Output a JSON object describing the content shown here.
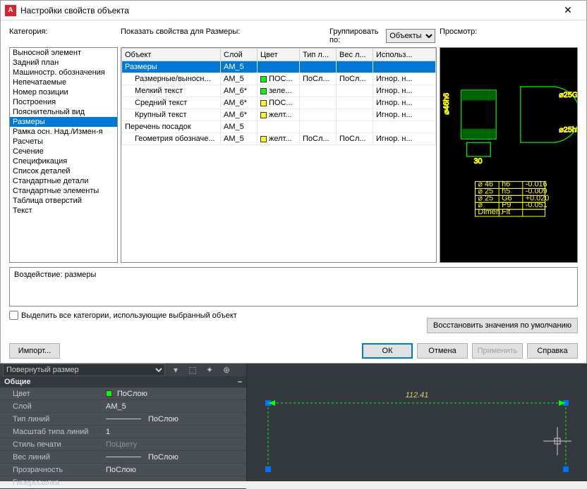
{
  "title": "Настройки свойств объекта",
  "labels": {
    "category": "Категория:",
    "show_props": "Показать свойства для Размеры:",
    "group_by": "Группировать по:",
    "group_value": "Объекты",
    "preview": "Просмотр:",
    "effect": "Воздействие: размеры",
    "select_all": "Выделить все категории, использующие выбранный объект",
    "restore": "Восстановить значения по умолчанию",
    "import": "Импорт...",
    "ok": "ОК",
    "cancel": "Отмена",
    "apply": "Применить",
    "help": "Справка"
  },
  "categories": [
    "Выносной элемент",
    "Задний план",
    "Машиностр. обозначения",
    "Непечатаемые",
    "Номер позиции",
    "Построения",
    "Пояснительный вид",
    "Размеры",
    "Рамка осн. Над./Измен-я",
    "Расчеты",
    "Сечение",
    "Спецификация",
    "Список деталей",
    "Стандартные детали",
    "Стандартные элементы",
    "Таблица отверстий",
    "Текст"
  ],
  "selected_category_index": 7,
  "columns": [
    "Объект",
    "Слой",
    "Цвет",
    "Тип л...",
    "Вес л...",
    "Использ..."
  ],
  "rows": [
    {
      "indent": 0,
      "object": "Размеры",
      "layer": "AM_5",
      "color": "",
      "color_hex": "",
      "linetype": "",
      "lineweight": "",
      "use": "",
      "selected": true
    },
    {
      "indent": 1,
      "object": "Размерные/выносн...",
      "layer": "AM_5",
      "color": "ПОС...",
      "color_hex": "#00ff00",
      "linetype": "ПоСл...",
      "lineweight": "ПоСл...",
      "use": "Игнор. н..."
    },
    {
      "indent": 1,
      "object": "Мелкий текст",
      "layer": "AM_6*",
      "color": "зеле...",
      "color_hex": "#00ff00",
      "linetype": "",
      "lineweight": "",
      "use": "Игнор. н..."
    },
    {
      "indent": 1,
      "object": "Средний текст",
      "layer": "AM_6*",
      "color": "ПОС...",
      "color_hex": "#ffff00",
      "linetype": "",
      "lineweight": "",
      "use": "Игнор. н..."
    },
    {
      "indent": 1,
      "object": "Крупный текст",
      "layer": "AM_6*",
      "color": "желт...",
      "color_hex": "#ffff00",
      "linetype": "",
      "lineweight": "",
      "use": "Игнор. н..."
    },
    {
      "indent": 0,
      "object": "Перечень посадок",
      "layer": "AM_5",
      "color": "",
      "color_hex": "",
      "linetype": "",
      "lineweight": "",
      "use": ""
    },
    {
      "indent": 1,
      "object": "Геометрия обозначе...",
      "layer": "AM_5",
      "color": "желт...",
      "color_hex": "#ffff00",
      "linetype": "ПоСл...",
      "lineweight": "ПоСл...",
      "use": "Игнор. н..."
    }
  ],
  "preview_table": [
    {
      "c1": "⌀ 46",
      "c2": "h6",
      "c3": "-0.016"
    },
    {
      "c1": "⌀ 25",
      "c2": "h5",
      "c3": "-0.009"
    },
    {
      "c1": "⌀ 25",
      "c2": "G6",
      "c3": "+0.020"
    },
    {
      "c1": "⌀",
      "c2": "P9",
      "c3": "-0.051"
    },
    {
      "c1": "Dimen.",
      "c2": "Fit",
      "c3": ""
    }
  ],
  "prop_panel": {
    "object_type": "Повернутый размер",
    "group": "Общие",
    "rows": [
      {
        "name": "Цвет",
        "value": "ПоСлою",
        "swatch": "#00ff00"
      },
      {
        "name": "Слой",
        "value": "AM_5"
      },
      {
        "name": "Тип линий",
        "value": "ПоСлою",
        "line": true
      },
      {
        "name": "Масштаб типа линий",
        "value": "1"
      },
      {
        "name": "Стиль печати",
        "value": "ПоЦвету",
        "readonly": true
      },
      {
        "name": "Вес линий",
        "value": "ПоСлою",
        "line": true
      },
      {
        "name": "Прозрачность",
        "value": "ПоСлою"
      },
      {
        "name": "Гиперссылка",
        "value": ""
      }
    ]
  },
  "viewport_dim": "112.41"
}
